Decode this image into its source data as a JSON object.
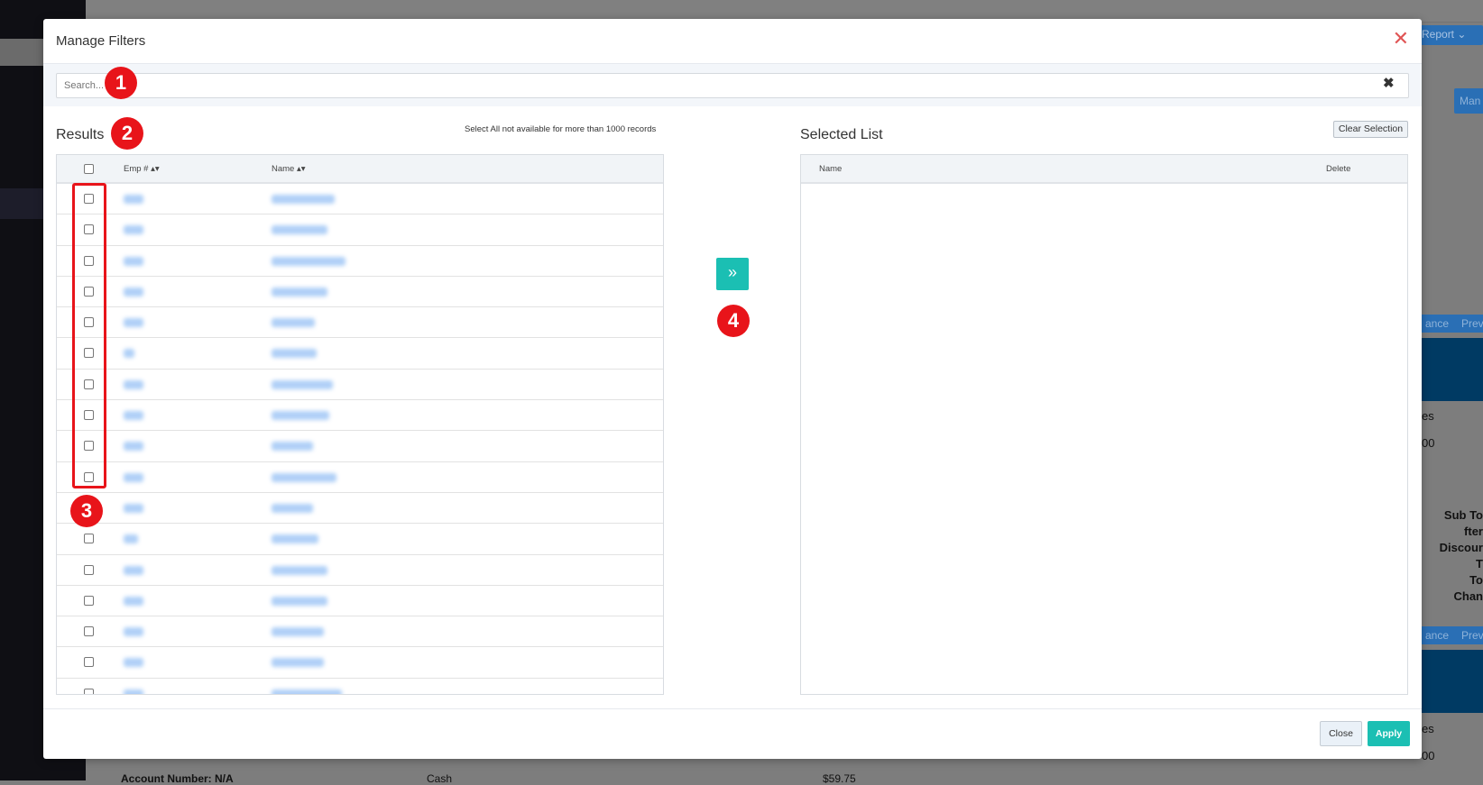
{
  "background": {
    "report_button": "Report",
    "man_button": "Man",
    "ance_button_1": "ance",
    "prev_button_1": "Prev",
    "ance_button_2": "ance",
    "prev_button_2": "Prev",
    "es_1": "es",
    "val_1": "00",
    "es_2": "es",
    "val_2": "00",
    "totals": [
      "Sub To",
      "fter Discour",
      "T",
      "To",
      "Chan"
    ],
    "account_number": "Account Number: N/A",
    "cash": "Cash",
    "amount": "$59.75"
  },
  "modal": {
    "title": "Manage Filters",
    "search_placeholder": "Search...",
    "results_heading": "Results",
    "select_all_note": "Select All not available for more than 1000 records",
    "columns": {
      "emp": "Emp # ▴▾",
      "name": "Name ▴▾"
    },
    "row_count": 17,
    "rows_blurred": true,
    "selected_heading": "Selected List",
    "clear_selection": "Clear Selection",
    "selected_columns": {
      "name": "Name",
      "delete": "Delete"
    },
    "move_button": "»",
    "close_button": "Close",
    "apply_button": "Apply",
    "close_icon": "✕",
    "clear_icon": "✖"
  },
  "annotations": [
    "1",
    "2",
    "3",
    "4"
  ],
  "colors": {
    "accent": "#1bbfb3",
    "annotation": "#e8141a",
    "link": "#9cc4f5"
  }
}
